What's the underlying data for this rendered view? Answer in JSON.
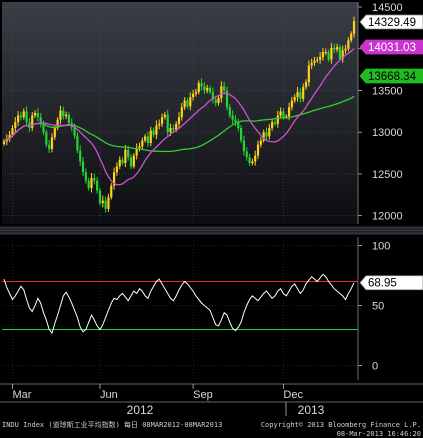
{
  "chart_data": [
    {
      "type": "candlestick",
      "x_months": [
        "Mar",
        "Jun",
        "Sep",
        "Dec"
      ],
      "x_years": [
        "2012",
        "2013"
      ],
      "y_ticks": [
        14500,
        14000,
        13500,
        13000,
        12500,
        12000
      ],
      "ylim": [
        11900,
        14560
      ],
      "badges": {
        "last": "14329.49",
        "ma_short": "14031.03",
        "ma_long": "13668.34"
      },
      "series": [
        {
          "name": "price",
          "color": "#ffffff"
        },
        {
          "name": "ma_short",
          "color": "#d050d0"
        },
        {
          "name": "ma_long",
          "color": "#33cc33"
        }
      ],
      "closes": [
        12890,
        12920,
        12970,
        13050,
        13120,
        13200,
        13180,
        13250,
        13120,
        13050,
        13200,
        13230,
        13180,
        13100,
        13000,
        12850,
        12800,
        12940,
        13050,
        13150,
        13260,
        13190,
        13210,
        13110,
        13060,
        12960,
        12780,
        12650,
        12520,
        12420,
        12330,
        12450,
        12420,
        12300,
        12150,
        12180,
        12080,
        12220,
        12360,
        12520,
        12590,
        12670,
        12630,
        12790,
        12700,
        12590,
        12720,
        12810,
        12830,
        12900,
        12950,
        12870,
        13020,
        12970,
        13080,
        13100,
        13180,
        13210,
        13000,
        13050,
        13030,
        13100,
        13180,
        13300,
        13380,
        13310,
        13420,
        13460,
        13480,
        13590,
        13550,
        13500,
        13530,
        13480,
        13390,
        13350,
        13410,
        13550,
        13500,
        13300,
        13200,
        13150,
        13120,
        13050,
        12900,
        12770,
        12700,
        12630,
        12650,
        12720,
        12850,
        12900,
        13000,
        12950,
        13050,
        13120,
        13100,
        13200,
        13250,
        13180,
        13190,
        13300,
        13380,
        13420,
        13480,
        13400,
        13540,
        13600,
        13800,
        13830,
        13860,
        13870,
        13900,
        13960,
        13960,
        13870,
        14010,
        13990,
        14020,
        13880,
        13980,
        14000,
        14100,
        14180,
        14330
      ]
    },
    {
      "type": "line",
      "y_ticks": [
        100,
        50,
        0
      ],
      "ylim": [
        -12,
        107
      ],
      "overbought": 70,
      "oversold": 30,
      "badge": "68.95",
      "series": [
        {
          "name": "rsi",
          "color": "#ffffff"
        }
      ],
      "values": [
        72,
        65,
        60,
        55,
        58,
        62,
        66,
        63,
        55,
        48,
        45,
        50,
        56,
        52,
        44,
        38,
        30,
        27,
        35,
        42,
        50,
        58,
        61,
        57,
        52,
        46,
        40,
        32,
        28,
        30,
        36,
        42,
        38,
        33,
        30,
        34,
        40,
        46,
        52,
        56,
        55,
        58,
        60,
        57,
        54,
        58,
        62,
        60,
        64,
        62,
        58,
        56,
        62,
        66,
        70,
        72,
        68,
        64,
        60,
        56,
        54,
        58,
        63,
        67,
        70,
        68,
        65,
        62,
        58,
        55,
        52,
        50,
        48,
        46,
        40,
        34,
        33,
        38,
        44,
        42,
        36,
        31,
        29,
        32,
        36,
        44,
        50,
        55,
        58,
        56,
        54,
        57,
        60,
        62,
        59,
        56,
        58,
        62,
        64,
        60,
        58,
        62,
        66,
        68,
        64,
        60,
        63,
        68,
        71,
        74,
        72,
        70,
        73,
        76,
        74,
        70,
        67,
        64,
        62,
        60,
        58,
        55,
        60,
        64,
        68.95
      ]
    }
  ],
  "footer": {
    "left": "INDU Index (道琼斯工业平均指数)  每日 08MAR2012-08MAR2013",
    "right_line1": "Copyright© 2013 Bloomberg Finance L.P.",
    "right_line2": "08-Mar-2013 16:46:20"
  }
}
